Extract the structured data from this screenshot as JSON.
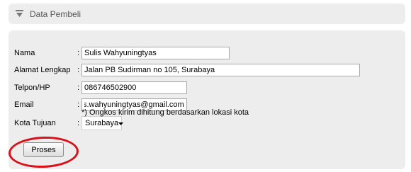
{
  "header": {
    "title": "Data Pembeli",
    "icon": "down-arrow-icon"
  },
  "form": {
    "nama": {
      "label": "Nama",
      "colon": ":",
      "value": "Sulis Wahyuningtyas"
    },
    "alamat": {
      "label": "Alamat Lengkap",
      "colon": ":",
      "value": "Jalan PB Sudirman no 105, Surabaya"
    },
    "telpon": {
      "label": "Telpon/HP",
      "colon": ":",
      "value": "086746502900"
    },
    "email": {
      "label": "Email",
      "colon": ":",
      "value": "s.wahyuningtyas@gmail.com"
    },
    "kota": {
      "label": "Kota Tujuan",
      "colon": ":",
      "selected": "Surabaya"
    },
    "note": "*) Ongkos kirim dihitung berdasarkan lokasi kota",
    "submit_label": "Proses"
  },
  "annotation": {
    "color": "#d8111b"
  }
}
